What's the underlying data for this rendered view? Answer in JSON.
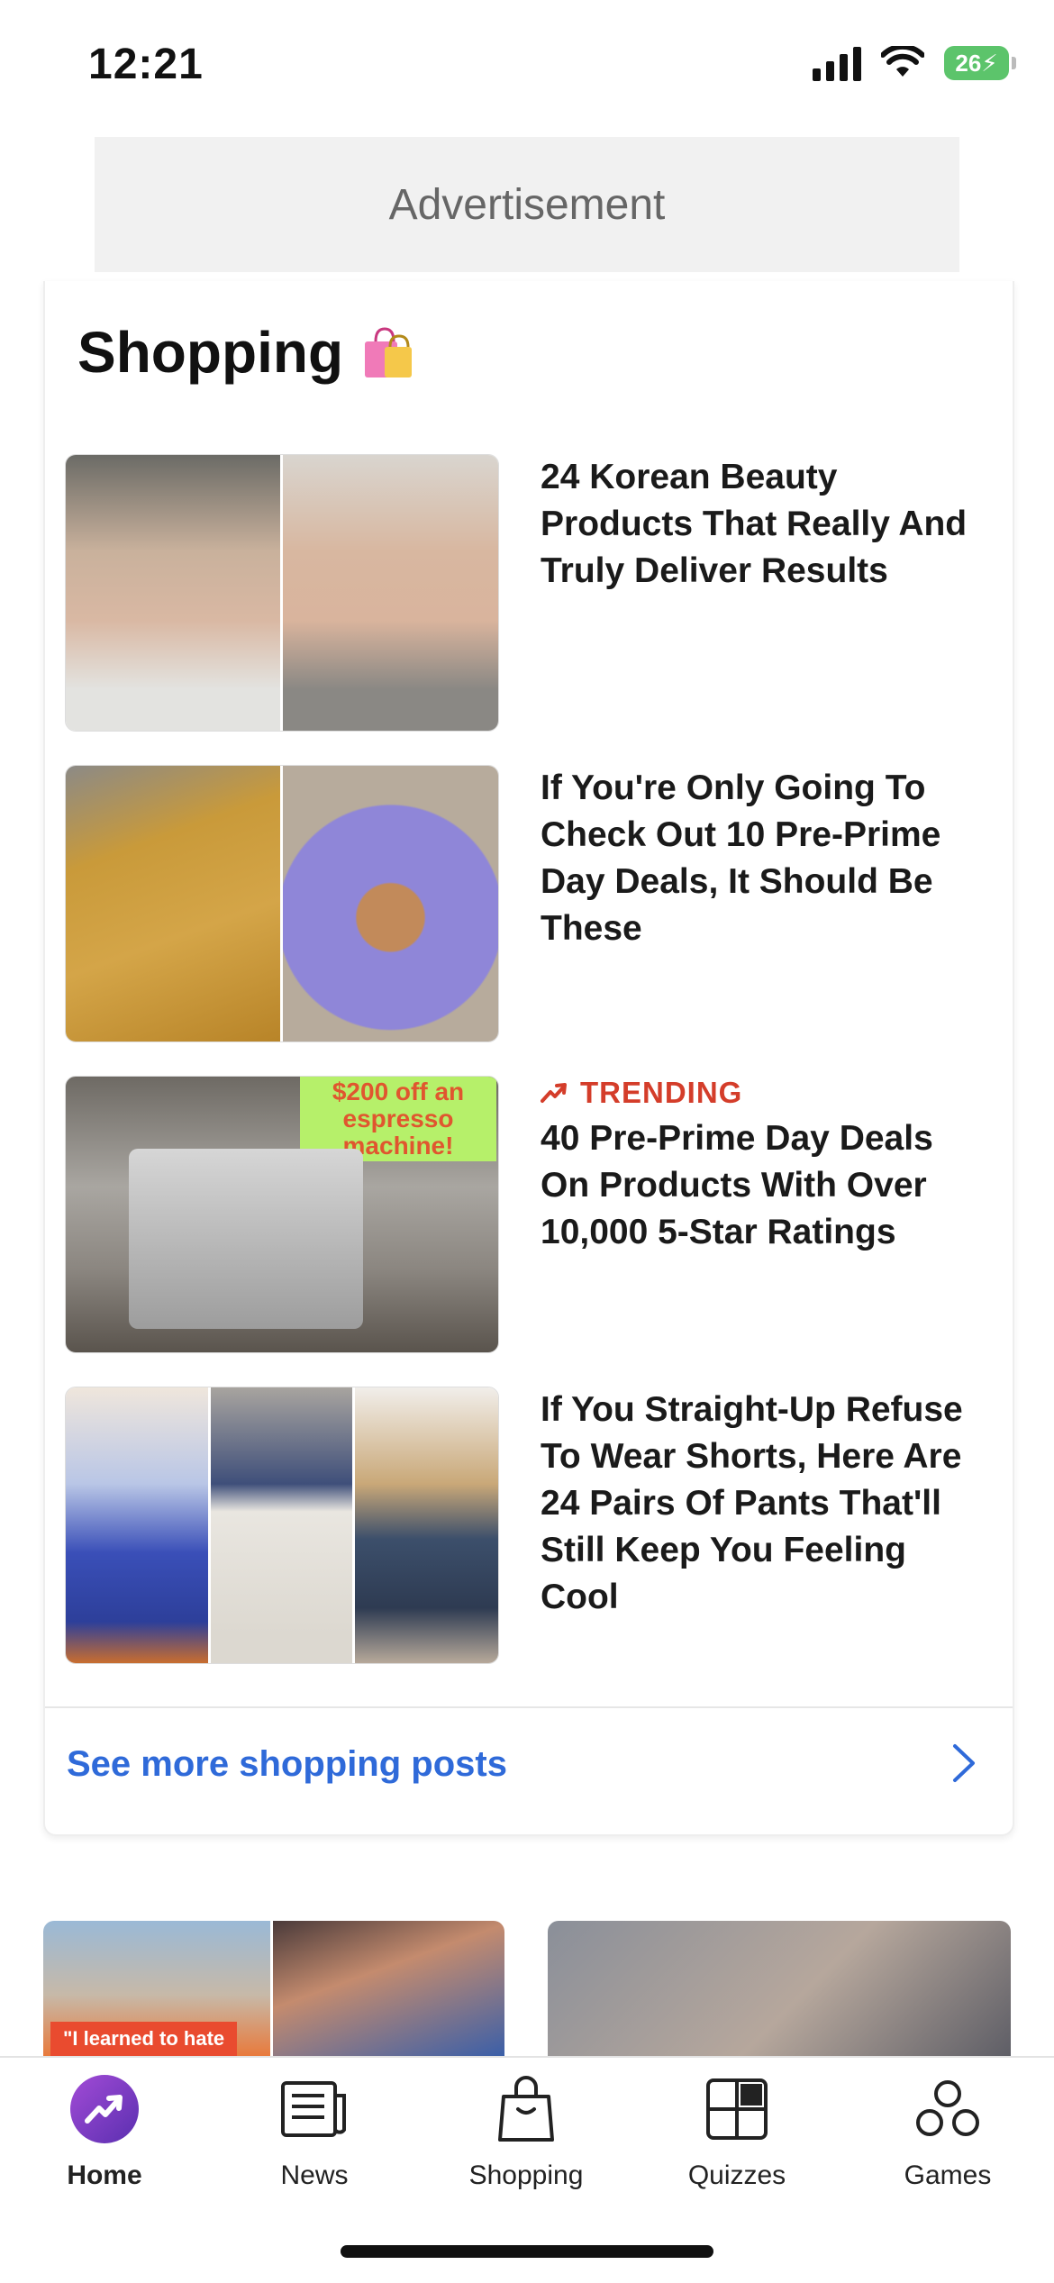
{
  "status_bar": {
    "time": "12:21",
    "battery": "26"
  },
  "ad": {
    "label": "Advertisement"
  },
  "shopping": {
    "title": "Shopping",
    "posts": [
      {
        "headline": "24 Korean Beauty Products That Really And Truly Deliver Results"
      },
      {
        "headline": "If You're Only Going To Check Out 10 Pre-Prime Day Deals, It Should Be These"
      },
      {
        "badge": "TRENDING",
        "overlay": "$200 off an espresso machine!",
        "headline": "40 Pre-Prime Day Deals On Products With Over 10,000 5-Star Ratings"
      },
      {
        "headline": "If You Straight-Up Refuse To Wear Shorts, Here Are 24 Pairs Of Pants That'll Still Keep You Feeling Cool"
      }
    ],
    "see_more": "See more shopping posts"
  },
  "lower_preview": {
    "tag": "\"I learned to hate"
  },
  "tabbar": {
    "items": [
      {
        "label": "Home",
        "icon": "trending-icon",
        "active": true
      },
      {
        "label": "News",
        "icon": "newspaper-icon"
      },
      {
        "label": "Shopping",
        "icon": "shopping-bag-icon"
      },
      {
        "label": "Quizzes",
        "icon": "quiz-grid-icon"
      },
      {
        "label": "Games",
        "icon": "games-icon"
      }
    ]
  },
  "colors": {
    "accent_blue": "#2f6ad9",
    "trending_red": "#d43d2a",
    "home_purple": "#7b3fc4"
  }
}
